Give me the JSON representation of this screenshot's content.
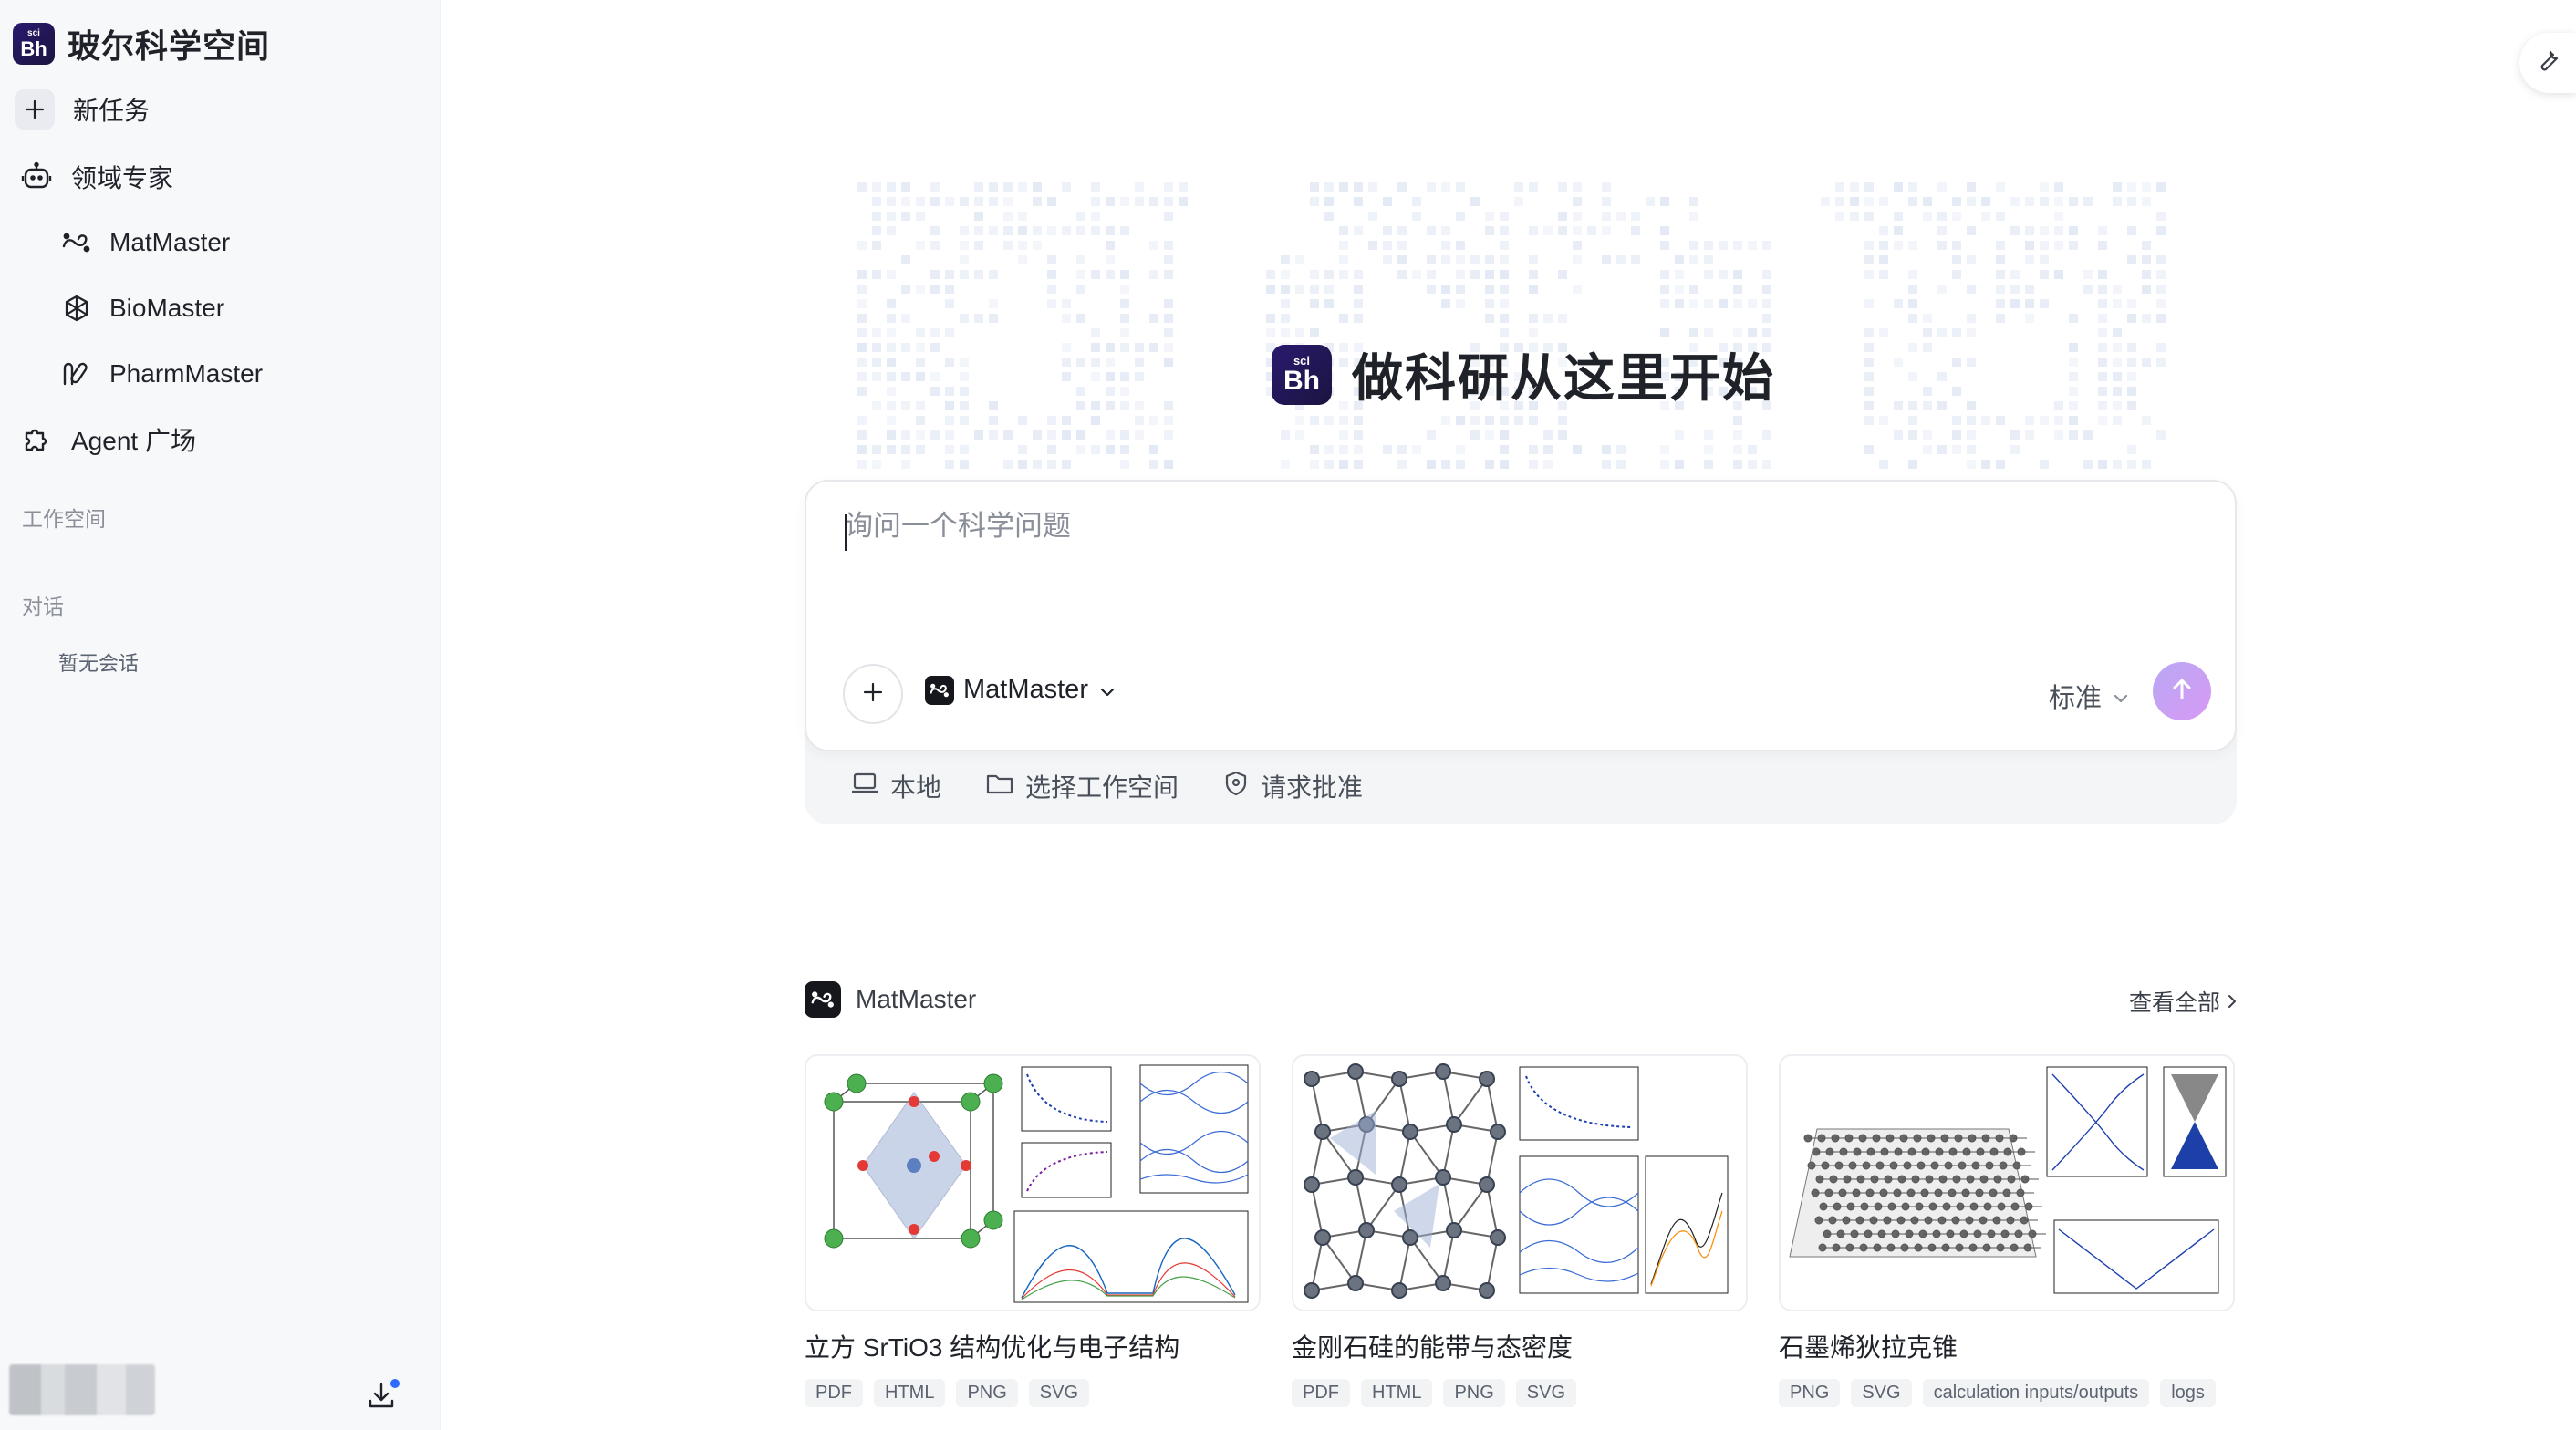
{
  "app": {
    "brand_name": "玻尔科学空间",
    "logo_top": "sci",
    "logo_main": "Bh"
  },
  "sidebar": {
    "new_task": "新任务",
    "domain_experts": "领域专家",
    "experts": [
      {
        "label": "MatMaster",
        "icon": "matmaster-icon"
      },
      {
        "label": "BioMaster",
        "icon": "biomaster-icon"
      },
      {
        "label": "PharmMaster",
        "icon": "pharmmaster-icon"
      }
    ],
    "agent_plaza": "Agent 广场",
    "workspace_section": "工作空间",
    "chat_section": "对话",
    "no_chats": "暂无会话"
  },
  "hero": {
    "title": "做科研从这里开始"
  },
  "composer": {
    "placeholder": "询问一个科学问题",
    "value": "",
    "agent": "MatMaster",
    "mode": "标准",
    "context_items": [
      {
        "label": "本地",
        "icon": "laptop-icon"
      },
      {
        "label": "选择工作空间",
        "icon": "folder-icon"
      },
      {
        "label": "请求批准",
        "icon": "shield-icon"
      }
    ]
  },
  "gallery": {
    "agent": "MatMaster",
    "view_all": "查看全部",
    "cards": [
      {
        "title": "立方 SrTiO3 结构优化与电子结构",
        "tags": [
          "PDF",
          "HTML",
          "PNG",
          "SVG"
        ]
      },
      {
        "title": "金刚石硅的能带与态密度",
        "tags": [
          "PDF",
          "HTML",
          "PNG",
          "SVG"
        ]
      },
      {
        "title": "石墨烯狄拉克锥",
        "tags": [
          "PNG",
          "SVG",
          "calculation inputs/outputs",
          "logs"
        ]
      }
    ]
  },
  "colors": {
    "accent_send": "#c9a0f4",
    "brand_dark": "#1b1440",
    "notification": "#2f6bff"
  }
}
